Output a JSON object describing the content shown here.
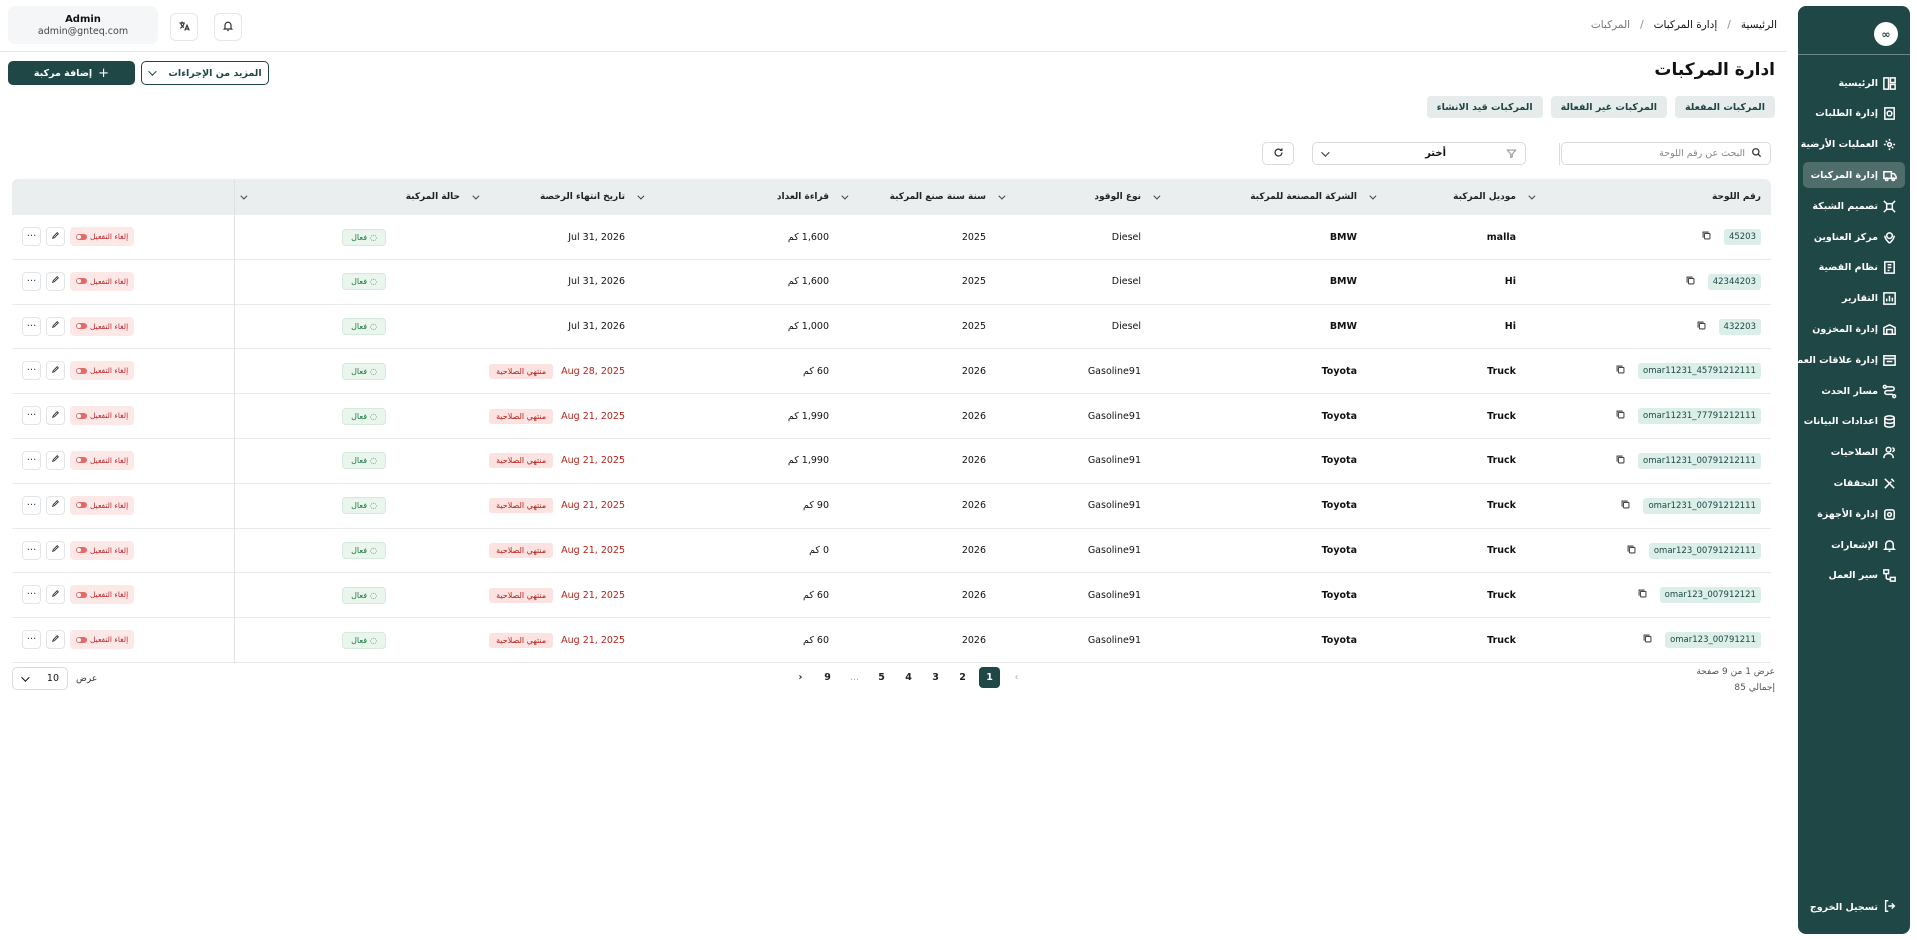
{
  "sidebar": {
    "logo": "∞",
    "items": [
      {
        "label": "الرئيسية",
        "icon": "dashboard-icon",
        "active": false
      },
      {
        "label": "إدارة الطلبات",
        "icon": "orders-icon",
        "active": false
      },
      {
        "label": "العمليات الأرضية",
        "icon": "operations-icon",
        "active": false
      },
      {
        "label": "إدارة المركبات",
        "icon": "vehicle-icon",
        "active": true
      },
      {
        "label": "تصميم الشبكة",
        "icon": "network-icon",
        "active": false
      },
      {
        "label": "مركز العناوين",
        "icon": "location-icon",
        "active": false
      },
      {
        "label": "نظام القضية",
        "icon": "case-icon",
        "active": false
      },
      {
        "label": "التقارير",
        "icon": "reports-icon",
        "active": false
      },
      {
        "label": "إدارة المخزون",
        "icon": "inventory-icon",
        "active": false
      },
      {
        "label": "إدارة علاقات العملاء",
        "icon": "crm-icon",
        "active": false
      },
      {
        "label": "مسار الحدث",
        "icon": "route-icon",
        "active": false
      },
      {
        "label": "اعدادات البيانات",
        "icon": "database-icon",
        "active": false
      },
      {
        "label": "الصلاحيات",
        "icon": "users-icon",
        "active": false
      },
      {
        "label": "التحققات",
        "icon": "tools-icon",
        "active": false
      },
      {
        "label": "إدارة الأجهزة",
        "icon": "device-icon",
        "active": false
      },
      {
        "label": "الإشعارات",
        "icon": "bell-icon",
        "active": false
      },
      {
        "label": "سير العمل",
        "icon": "workflow-icon",
        "active": false
      }
    ],
    "logout": "تسجيل الخروج"
  },
  "header": {
    "user_name": "Admin",
    "user_email": "admin@gnteq.com",
    "breadcrumb": [
      "الرئيسية",
      "إدارة المركبات",
      "المركبات"
    ]
  },
  "page": {
    "title": "ادارة المركبات",
    "add_button": "إضافة مركبة",
    "more_actions": "المزيد من الإجراءات",
    "tabs": [
      "المركبات المفعلة",
      "المركبات غير الفعالة",
      "المركبات قيد الانشاء"
    ]
  },
  "filters": {
    "search_placeholder": "البحث عن رقم اللوحة",
    "select_value": "أختر"
  },
  "table": {
    "columns": [
      "رقم اللوحة",
      "موديل المركبة",
      "الشركة المصنعة للمركبة",
      "نوع الوقود",
      "سنة سنة صنع المركبة",
      "قراءة العداد",
      "تاريخ انتهاء الرخصة",
      "حالة المركبة"
    ],
    "status_label": "فعال",
    "expired_label": "منتهي الصلاحية",
    "deactivate_label": "إلغاء التفعيل",
    "more_label": "···",
    "rows": [
      {
        "plate": "45203",
        "model": "malla",
        "make": "BMW",
        "fuel": "Diesel",
        "year": "2025",
        "odometer": "1,600 كم",
        "license": "Jul 31, 2026",
        "expired": false
      },
      {
        "plate": "42344203",
        "model": "Hi",
        "make": "BMW",
        "fuel": "Diesel",
        "year": "2025",
        "odometer": "1,600 كم",
        "license": "Jul 31, 2026",
        "expired": false
      },
      {
        "plate": "432203",
        "model": "Hi",
        "make": "BMW",
        "fuel": "Diesel",
        "year": "2025",
        "odometer": "1,000 كم",
        "license": "Jul 31, 2026",
        "expired": false
      },
      {
        "plate": "omar11231_45791212111",
        "model": "Truck",
        "make": "Toyota",
        "fuel": "Gasoline91",
        "year": "2026",
        "odometer": "60 كم",
        "license": "Aug 28, 2025",
        "expired": true
      },
      {
        "plate": "omar11231_77791212111",
        "model": "Truck",
        "make": "Toyota",
        "fuel": "Gasoline91",
        "year": "2026",
        "odometer": "1,990 كم",
        "license": "Aug 21, 2025",
        "expired": true
      },
      {
        "plate": "omar11231_00791212111",
        "model": "Truck",
        "make": "Toyota",
        "fuel": "Gasoline91",
        "year": "2026",
        "odometer": "1,990 كم",
        "license": "Aug 21, 2025",
        "expired": true
      },
      {
        "plate": "omar1231_00791212111",
        "model": "Truck",
        "make": "Toyota",
        "fuel": "Gasoline91",
        "year": "2026",
        "odometer": "90 كم",
        "license": "Aug 21, 2025",
        "expired": true
      },
      {
        "plate": "omar123_00791212111",
        "model": "Truck",
        "make": "Toyota",
        "fuel": "Gasoline91",
        "year": "2026",
        "odometer": "0 كم",
        "license": "Aug 21, 2025",
        "expired": true
      },
      {
        "plate": "omar123_007912121",
        "model": "Truck",
        "make": "Toyota",
        "fuel": "Gasoline91",
        "year": "2026",
        "odometer": "60 كم",
        "license": "Aug 21, 2025",
        "expired": true
      },
      {
        "plate": "omar123_00791211",
        "model": "Truck",
        "make": "Toyota",
        "fuel": "Gasoline91",
        "year": "2026",
        "odometer": "60 كم",
        "license": "Aug 21, 2025",
        "expired": true
      }
    ]
  },
  "pagination": {
    "pages": [
      "1",
      "2",
      "3",
      "4",
      "5",
      "...",
      "9"
    ],
    "current": "1",
    "prev": "‹",
    "next": "›",
    "info_line1": "عرض 1 من 9 صفحة",
    "info_line2": "إجمالي 85",
    "page_size_label": "عرض",
    "page_size": "10"
  },
  "colors": {
    "brand": "#1e4745",
    "danger": "#b42318",
    "success": "#1a7a3d"
  }
}
